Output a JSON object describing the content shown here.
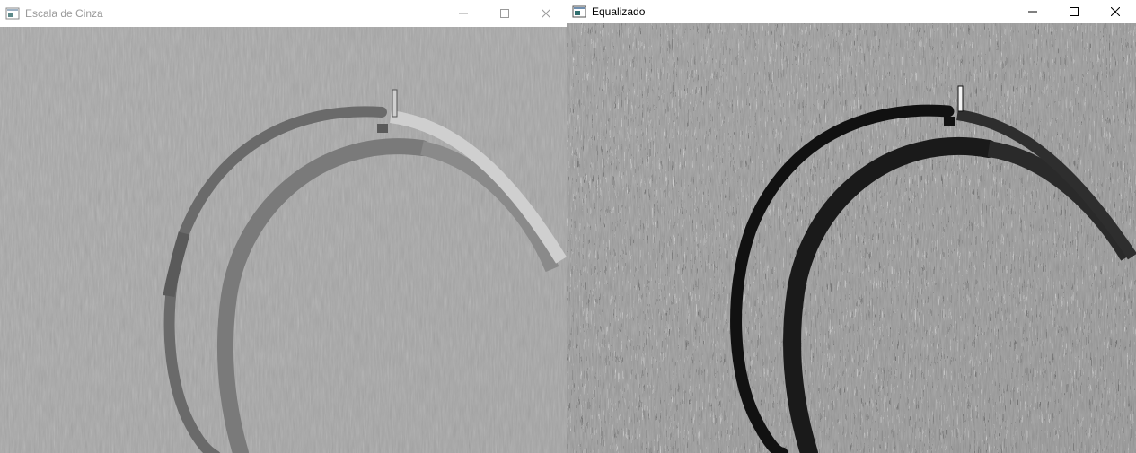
{
  "windows": [
    {
      "title": "Escala de Cinza",
      "focused": false,
      "icon": "opencv-window-icon",
      "controls": [
        "minimize",
        "maximize",
        "close"
      ]
    },
    {
      "title": "Equalizado",
      "focused": true,
      "icon": "opencv-window-icon",
      "controls": [
        "minimize",
        "maximize",
        "close"
      ]
    }
  ],
  "colors": {
    "titlebar_bg": "#ffffff",
    "inactive_title": "#9a9a9a",
    "active_title": "#000000"
  }
}
